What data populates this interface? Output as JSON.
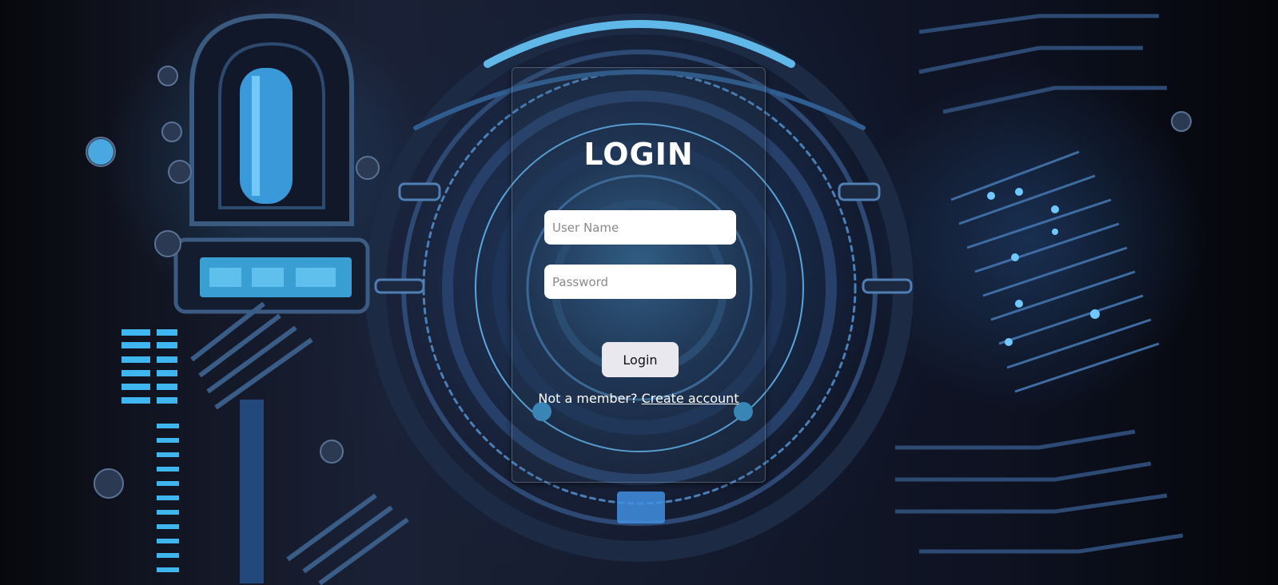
{
  "login": {
    "title": "LOGIN",
    "username_placeholder": "User Name",
    "password_placeholder": "Password",
    "button_label": "Login",
    "signup_prompt": "Not a member?",
    "signup_link": "Create account"
  },
  "colors": {
    "background_dark": "#0d1120",
    "accent_blue": "#3fb6f0",
    "button_bg": "#e9e8ee",
    "text": "#ffffff"
  }
}
